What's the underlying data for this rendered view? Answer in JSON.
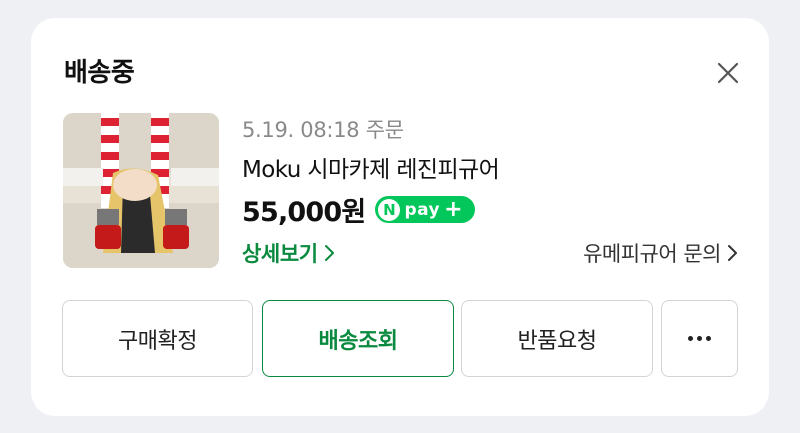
{
  "header": {
    "title": "배송중"
  },
  "order": {
    "date": "5.19. 08:18 주문",
    "product_name": "Moku 시마카제 레진피규어",
    "price": "55,000원",
    "npay": {
      "n": "N",
      "pay": "pay",
      "plus": "+"
    },
    "detail_link": "상세보기",
    "inquiry_link": "유메피규어 문의"
  },
  "actions": {
    "confirm": "구매확정",
    "track": "배송조회",
    "return": "반품요청"
  },
  "colors": {
    "accent": "#0a8a3f",
    "npay_green": "#03c75a",
    "background": "#eef0f3"
  },
  "icons": {
    "close": "close-icon",
    "chevron": "chevron-right-icon",
    "more": "more-dots-icon"
  }
}
